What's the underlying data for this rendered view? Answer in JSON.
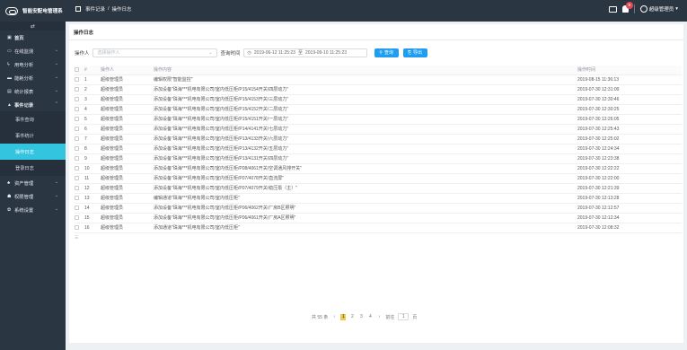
{
  "app": {
    "title": "智能安配电管理系"
  },
  "breadcrumb": {
    "section": "事件记录",
    "separator": "/",
    "page": "操作日志"
  },
  "header": {
    "badge_count": "9",
    "user_name": "超级管理员",
    "user_caret": "▾"
  },
  "sidebar": {
    "collapse_glyph": "⇄",
    "items": [
      {
        "label": "首页",
        "icon": "▣",
        "has_chevron": false
      },
      {
        "label": "在线监测",
        "icon": "▭",
        "has_chevron": true
      },
      {
        "label": "用电分析",
        "icon": "ϟ",
        "has_chevron": true
      },
      {
        "label": "能耗分析",
        "icon": "▬",
        "has_chevron": true
      },
      {
        "label": "统计报表",
        "icon": "▤",
        "has_chevron": true
      },
      {
        "label": "事件记录",
        "icon": "▲",
        "has_chevron": true,
        "expanded": true
      }
    ],
    "subitems": [
      {
        "label": "事件查询"
      },
      {
        "label": "事件统计"
      },
      {
        "label": "操作日志",
        "active": true
      },
      {
        "label": "登录日志"
      }
    ],
    "items_after": [
      {
        "label": "资产管理",
        "icon": "♣"
      },
      {
        "label": "权限管理",
        "icon": "☗"
      },
      {
        "label": "系统设置",
        "icon": "✿"
      }
    ],
    "chevron_down": "⌄",
    "chevron_up": "⌃"
  },
  "page": {
    "title": "操作日志"
  },
  "filters": {
    "operator_label": "操作人",
    "operator_placeholder": "选择操作人",
    "time_label": "查询时间",
    "clock_glyph": "◷",
    "date_start": "2019-06-12 11:25:23",
    "date_sep": "至",
    "date_end": "2019-09-10 11:25:23",
    "search_button": "查询",
    "export_button": "导出"
  },
  "table": {
    "headers": [
      "#",
      "操作人",
      "操作内容",
      "操作时间"
    ],
    "rows": [
      {
        "no": "1",
        "user": "超级管理员",
        "content": "编辑权限\"智能监控\"",
        "time": "2019-08-15 11:36:13"
      },
      {
        "no": "2",
        "user": "超级管理员",
        "content": "添加设备\"珠海***机电有限公司/室内低压柜/P15/4154开关/四层动力\"",
        "time": "2019-07-30 12:31:09"
      },
      {
        "no": "3",
        "user": "超级管理员",
        "content": "添加设备\"珠海***机电有限公司/室内低压柜/P15/4153开关/三层动力\"",
        "time": "2019-07-30 12:30:46"
      },
      {
        "no": "4",
        "user": "超级管理员",
        "content": "添加设备\"珠海***机电有限公司/室内低压柜/P15/4152开关/二层动力\"",
        "time": "2019-07-30 12:30:25"
      },
      {
        "no": "5",
        "user": "超级管理员",
        "content": "添加设备\"珠海***机电有限公司/室内低压柜/P15/4151开关/一层动力\"",
        "time": "2019-07-30 12:26:05"
      },
      {
        "no": "6",
        "user": "超级管理员",
        "content": "添加设备\"珠海***机电有限公司/室内低压柜/P14/4141开关/七层动力\"",
        "time": "2019-07-30 12:25:43"
      },
      {
        "no": "7",
        "user": "超级管理员",
        "content": "添加设备\"珠海***机电有限公司/室内低压柜/P13/4133开关/六层动力\"",
        "time": "2019-07-30 12:25:02"
      },
      {
        "no": "8",
        "user": "超级管理员",
        "content": "添加设备\"珠海***机电有限公司/室内低压柜/P13/4132开关/五层动力\"",
        "time": "2019-07-30 12:24:34"
      },
      {
        "no": "9",
        "user": "超级管理员",
        "content": "添加设备\"珠海***机电有限公司/室内低压柜/P13/4131开关/四层动力\"",
        "time": "2019-07-30 12:23:38"
      },
      {
        "no": "10",
        "user": "超级管理员",
        "content": "添加设备\"珠海***机电有限公司/室内低压柜/P08/4061开关/空调通风排开关\"",
        "time": "2019-07-30 12:22:22"
      },
      {
        "no": "11",
        "user": "超级管理员",
        "content": "添加设备\"珠海***机电有限公司/室内低压柜/P07/4078开关/直流屏\"",
        "time": "2019-07-30 12:22:00"
      },
      {
        "no": "12",
        "user": "超级管理员",
        "content": "添加设备\"珠海***机电有限公司/室内低压柜/P07/4079开关/稳压泵（主）\"",
        "time": "2019-07-30 12:21:39"
      },
      {
        "no": "13",
        "user": "超级管理员",
        "content": "编辑通道\"珠海***机电有限公司/室内低压柜\"",
        "time": "2019-07-30 12:13:28"
      },
      {
        "no": "14",
        "user": "超级管理员",
        "content": "添加设备\"珠海***机电有限公司/室内低压柜/P06/4062开关/厂房B区照明\"",
        "time": "2019-07-30 12:12:57"
      },
      {
        "no": "15",
        "user": "超级管理员",
        "content": "添加设备\"珠海***机电有限公司/室内低压柜/P06/4061开关/厂房A区照明\"",
        "time": "2019-07-30 12:12:34"
      },
      {
        "no": "16",
        "user": "超级管理员",
        "content": "添加通道\"珠海***机电有限公司/室内低压柜\"",
        "time": "2019-07-30 12:08:32"
      }
    ],
    "footer_glyph": "☰"
  },
  "pagination": {
    "total": "共 55 条",
    "prev": "‹",
    "pages": [
      "1",
      "2",
      "3",
      "4"
    ],
    "active_page": "1",
    "next": "›",
    "goto_label": "前往",
    "goto_value": "1",
    "page_suffix": "页"
  }
}
